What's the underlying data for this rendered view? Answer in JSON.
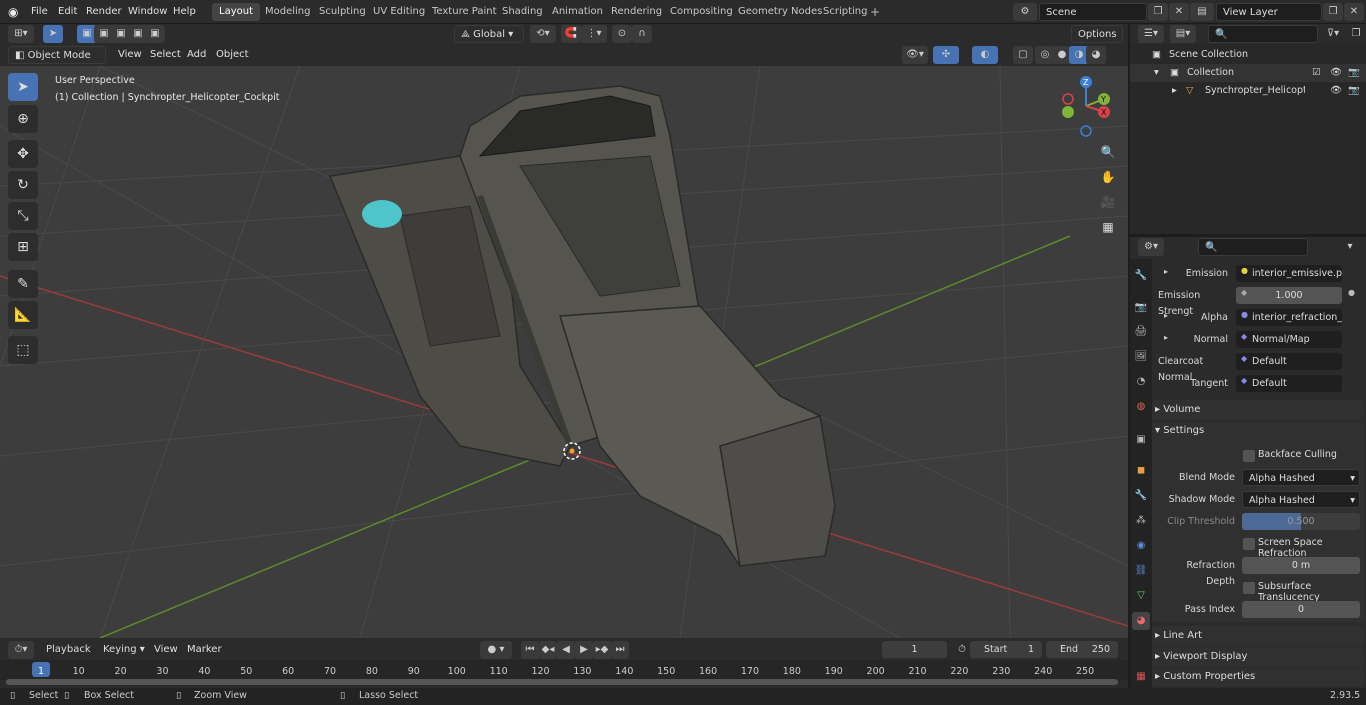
{
  "top_menu": [
    "File",
    "Edit",
    "Render",
    "Window",
    "Help"
  ],
  "workspaces": [
    "Layout",
    "Modeling",
    "Sculpting",
    "UV Editing",
    "Texture Paint",
    "Shading",
    "Animation",
    "Rendering",
    "Compositing",
    "Geometry Nodes",
    "Scripting"
  ],
  "scene_name": "Scene",
  "view_layer_name": "View Layer",
  "options_label": "Options",
  "transform_orientation": "Global",
  "header": {
    "mode": "Object Mode",
    "menus": [
      "View",
      "Select",
      "Add",
      "Object"
    ]
  },
  "viewport": {
    "perspective": "User Perspective",
    "collection_info": "(1) Collection | Synchropter_Helicopter_Cockpit"
  },
  "gizmo": {
    "x": "X",
    "y": "Y",
    "z": "Z"
  },
  "outliner": {
    "scene_collection": "Scene Collection",
    "collection": "Collection",
    "object": "Synchropter_Helicopter_C"
  },
  "properties": {
    "rows": [
      {
        "label": "Emission",
        "value": "interior_emissive.png"
      },
      {
        "label": "Emission Strengt",
        "value": "1.000"
      },
      {
        "label": "Alpha",
        "value": "interior_refraction_in..."
      },
      {
        "label": "Normal",
        "value": "Normal/Map"
      },
      {
        "label": "Clearcoat Normal",
        "value": "Default"
      },
      {
        "label": "Tangent",
        "value": "Default"
      }
    ],
    "volume": "Volume",
    "settings": "Settings",
    "backface_culling": "Backface Culling",
    "blend_mode_label": "Blend Mode",
    "blend_mode": "Alpha Hashed",
    "shadow_mode_label": "Shadow Mode",
    "shadow_mode": "Alpha Hashed",
    "clip_threshold_label": "Clip Threshold",
    "clip_threshold": "0.500",
    "screen_space_refraction": "Screen Space Refraction",
    "refraction_depth_label": "Refraction Depth",
    "refraction_depth": "0 m",
    "subsurface_translucency": "Subsurface Translucency",
    "pass_index_label": "Pass Index",
    "pass_index": "0",
    "line_art": "Line Art",
    "viewport_display": "Viewport Display",
    "custom_properties": "Custom Properties"
  },
  "timeline": {
    "menus": [
      "Playback",
      "Keying",
      "View",
      "Marker"
    ],
    "current_frame": "1",
    "start_label": "Start",
    "start": "1",
    "end_label": "End",
    "end": "250",
    "ticks": [
      "1",
      "10",
      "20",
      "30",
      "40",
      "50",
      "60",
      "70",
      "80",
      "90",
      "100",
      "110",
      "120",
      "130",
      "140",
      "150",
      "160",
      "170",
      "180",
      "190",
      "200",
      "210",
      "220",
      "230",
      "240",
      "250"
    ]
  },
  "status": {
    "select": "Select",
    "box_select": "Box Select",
    "zoom_view": "Zoom View",
    "lasso_select": "Lasso Select",
    "version": "2.93.5"
  }
}
